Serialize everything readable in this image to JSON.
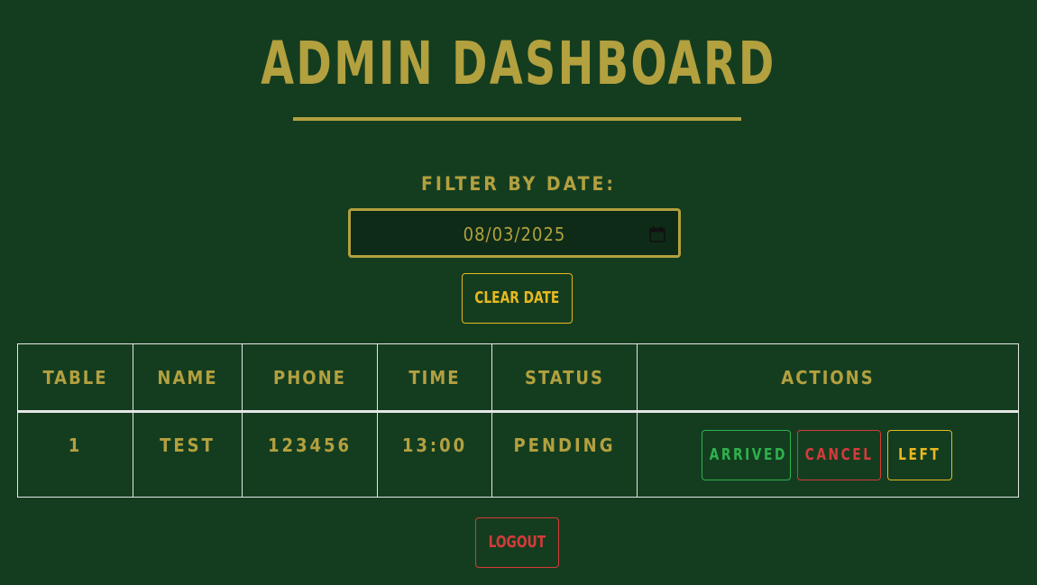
{
  "header": {
    "title": "ADMIN DASHBOARD"
  },
  "filter": {
    "label": "FILTER BY DATE:",
    "date_value": "08/03/2025",
    "calendar_icon": "calendar-icon",
    "clear_label": "CLEAR DATE"
  },
  "table": {
    "columns": [
      "TABLE",
      "NAME",
      "PHONE",
      "TIME",
      "STATUS",
      "ACTIONS"
    ],
    "rows": [
      {
        "table": "1",
        "name": "TEST",
        "phone": "123456",
        "time": "13:00",
        "status": "PENDING",
        "actions": {
          "arrived": "ARRIVED",
          "cancel": "CANCEL",
          "left": "LEFT"
        }
      }
    ]
  },
  "footer": {
    "logout_label": "LOGOUT"
  },
  "colors": {
    "background": "#143d20",
    "accent_gold": "#b3a03f",
    "button_yellow": "#e8b820",
    "button_green": "#2eb24c",
    "button_red": "#d63a3a"
  }
}
